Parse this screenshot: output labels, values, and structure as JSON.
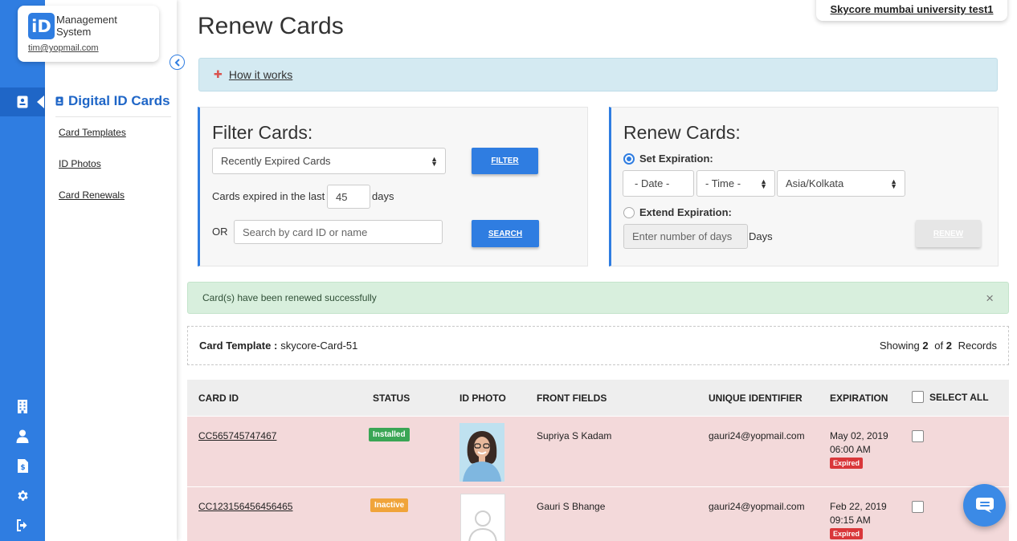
{
  "brand": {
    "logo_letters": "iD",
    "name_line1": "Management",
    "name_line2": "System",
    "email": "tim@yopmail.com"
  },
  "org": "Skycore mumbai university test1",
  "sidebar": {
    "title": "Digital ID Cards",
    "links": [
      "Card Templates",
      "ID Photos",
      "Card Renewals"
    ]
  },
  "rail_icons": [
    "id-card-icon",
    "building-icon",
    "user-icon",
    "document-dollar-icon",
    "gear-icon",
    "logout-icon"
  ],
  "page": {
    "title": "Renew Cards",
    "how_it_works": "How it works"
  },
  "filter": {
    "heading": "Filter Cards:",
    "select_value": "Recently Expired Cards",
    "filter_button": "FILTER",
    "expired_prefix": "Cards expired in the last",
    "days_value": "45",
    "days_suffix": "days",
    "or_label": "OR",
    "search_placeholder": "Search by card ID or name",
    "search_button": "SEARCH"
  },
  "renew": {
    "heading": "Renew Cards:",
    "set_label": "Set Expiration:",
    "date_value": "- Date -",
    "time_value": "- Time -",
    "timezone_value": "Asia/Kolkata",
    "extend_label": "Extend Expiration:",
    "days_placeholder": "Enter number of days",
    "days_suffix": "Days",
    "renew_button": "RENEW"
  },
  "alert": {
    "message": "Card(s) have been renewed successfully",
    "close": "×"
  },
  "template_bar": {
    "label": "Card Template :",
    "value": "skycore-Card-51",
    "showing_prefix": "Showing",
    "shown": "2",
    "of": "of",
    "total": "2",
    "records": "Records"
  },
  "table": {
    "headers": [
      "CARD ID",
      "STATUS",
      "ID PHOTO",
      "FRONT FIELDS",
      "UNIQUE IDENTIFIER",
      "EXPIRATION",
      "SELECT ALL"
    ],
    "rows": [
      {
        "card_id": "CC565745747467",
        "status": "Installed",
        "front_fields": "Supriya S Kadam",
        "unique_identifier": "gauri24@yopmail.com",
        "exp_date": "May 02, 2019",
        "exp_time": "06:00 AM",
        "exp_badge": "Expired"
      },
      {
        "card_id": "CC123156456456465",
        "status": "Inactive",
        "front_fields": "Gauri S Bhange",
        "unique_identifier": "gauri24@yopmail.com",
        "exp_date": "Feb 22, 2019",
        "exp_time": "09:15 AM",
        "exp_badge": "Expired"
      }
    ]
  },
  "colors": {
    "primary": "#2f7de1",
    "row_expired": "#f3d9da",
    "alert_success": "#d8efdd",
    "info_bar": "#d4eaf2",
    "installed": "#3aa655",
    "inactive": "#f0a43a",
    "expired": "#d9373a"
  }
}
